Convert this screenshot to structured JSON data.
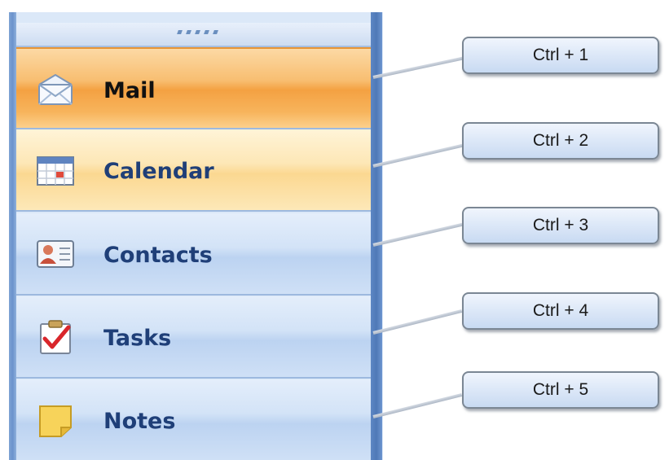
{
  "navigation": {
    "buttons": [
      {
        "label": "Mail",
        "icon": "envelope-icon",
        "selected": true
      },
      {
        "label": "Calendar",
        "icon": "calendar-icon",
        "selected": false
      },
      {
        "label": "Contacts",
        "icon": "contact-card-icon",
        "selected": false
      },
      {
        "label": "Tasks",
        "icon": "clipboard-check-icon",
        "selected": false
      },
      {
        "label": "Notes",
        "icon": "sticky-note-icon",
        "selected": false
      }
    ]
  },
  "shortcuts": [
    "Ctrl + 1",
    "Ctrl + 2",
    "Ctrl + 3",
    "Ctrl + 4",
    "Ctrl + 5"
  ],
  "colors": {
    "selected_accent": "#f4a142",
    "hover_accent": "#fbd891",
    "pane_blue": "#4f79b7",
    "label_blue": "#1f3f78"
  }
}
